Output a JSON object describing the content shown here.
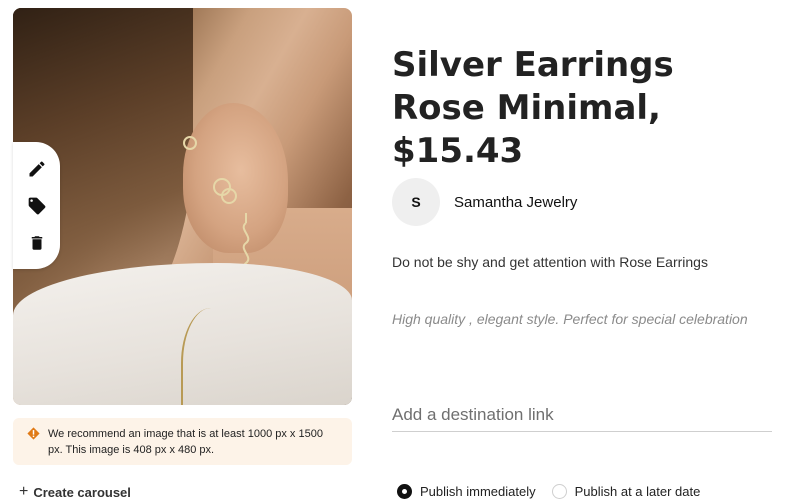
{
  "product": {
    "title": "Silver Earrings Rose Minimal, $15.43",
    "seller_initial": "S",
    "seller_name": "Samantha Jewelry",
    "description": "Do not be shy and get attention with Rose Earrings",
    "subtext": "High quality , elegant style. Perfect for special celebration"
  },
  "image_tools": [
    {
      "icon": "pencil-icon",
      "label": "edit"
    },
    {
      "icon": "tag-icon",
      "label": "tag"
    },
    {
      "icon": "trash-icon",
      "label": "delete"
    }
  ],
  "warning": {
    "icon": "warning-icon",
    "text": "We recommend an image that is at least 1000 px x 1500 px. This image is 408 px x 480 px."
  },
  "carousel": {
    "label": "Create carousel"
  },
  "destination": {
    "placeholder": "Add a destination link",
    "value": ""
  },
  "publish": {
    "options": [
      {
        "label": "Publish immediately",
        "selected": true
      },
      {
        "label": "Publish at a later date",
        "selected": false
      }
    ]
  },
  "colors": {
    "warning_bg": "#fdf3e8",
    "warning_icon": "#e07a16",
    "title": "#222222"
  }
}
